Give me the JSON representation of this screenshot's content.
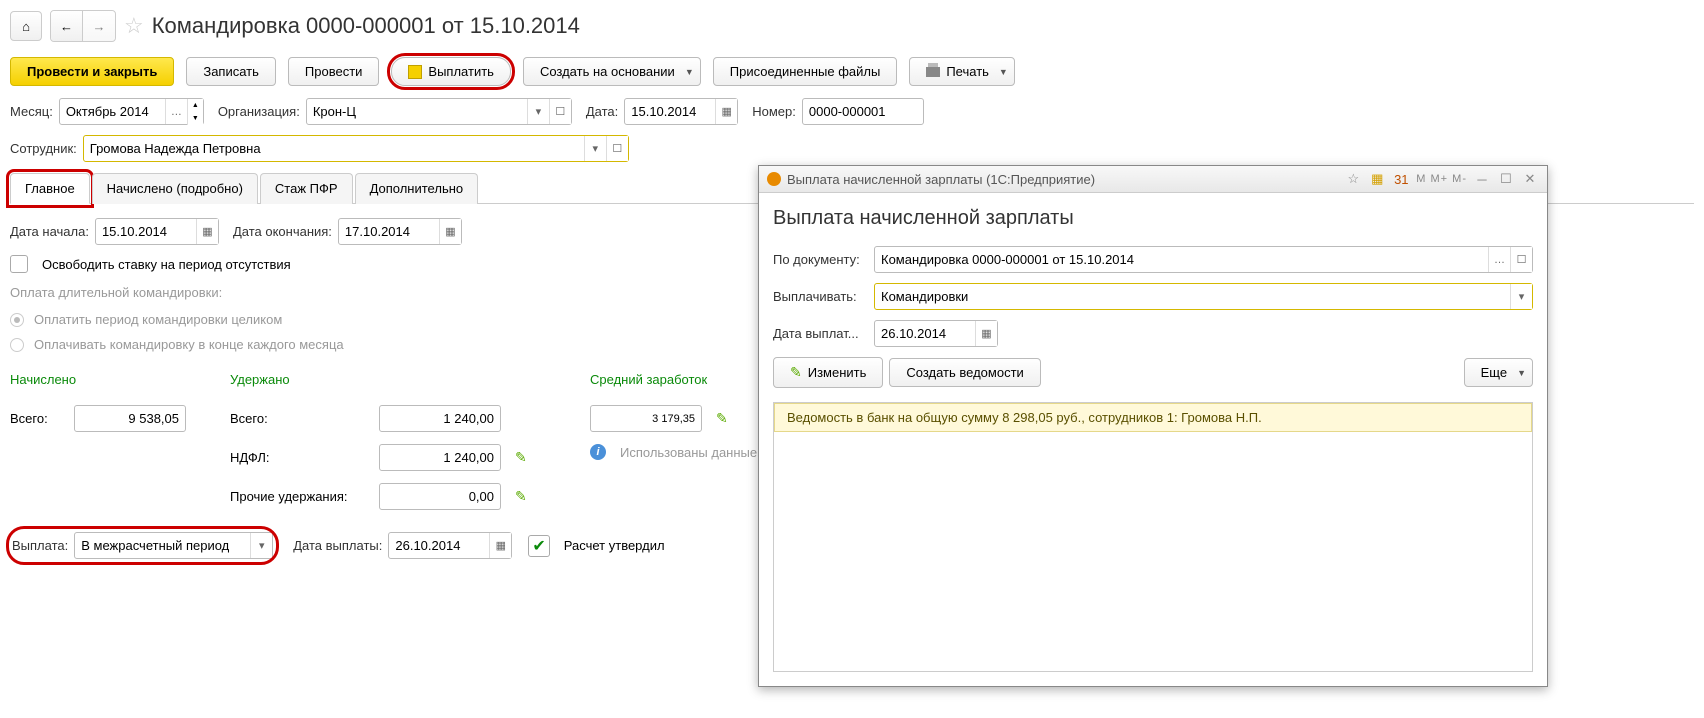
{
  "page_title": "Командировка 0000-000001 от 15.10.2014",
  "toolbar": {
    "post_close": "Провести и закрыть",
    "save": "Записать",
    "post": "Провести",
    "pay": "Выплатить",
    "create_based": "Создать на основании",
    "attached_files": "Присоединенные файлы",
    "print": "Печать"
  },
  "form": {
    "month_label": "Месяц:",
    "month_value": "Октябрь 2014",
    "org_label": "Организация:",
    "org_value": "Крон-Ц",
    "date_label": "Дата:",
    "date_value": "15.10.2014",
    "number_label": "Номер:",
    "number_value": "0000-000001",
    "employee_label": "Сотрудник:",
    "employee_value": "Громова Надежда Петровна"
  },
  "tabs": [
    "Главное",
    "Начислено (подробно)",
    "Стаж ПФР",
    "Дополнительно"
  ],
  "main_tab": {
    "start_date_label": "Дата начала:",
    "start_date": "15.10.2014",
    "end_date_label": "Дата окончания:",
    "end_date": "17.10.2014",
    "free_rate": "Освободить ставку на период отсутствия",
    "long_trip_label": "Оплата длительной командировки:",
    "radio_whole": "Оплатить период командировки целиком",
    "radio_monthly": "Оплачивать командировку в конце каждого месяца",
    "accrued_header": "Начислено",
    "withheld_header": "Удержано",
    "avg_salary_header": "Средний заработок",
    "total_label": "Всего:",
    "accrued_total": "9 538,05",
    "withheld_total": "1 240,00",
    "ndfl_label": "НДФЛ:",
    "ndfl_value": "1 240,00",
    "other_label": "Прочие удержания:",
    "other_value": "0,00",
    "avg_value": "3 179,35",
    "data_used_label": "Использованы данные о",
    "payment_label": "Выплата:",
    "payment_value": "В межрасчетный период",
    "pay_date_label": "Дата выплаты:",
    "pay_date_value": "26.10.2014",
    "calc_approved": "Расчет утвердил"
  },
  "dialog": {
    "titlebar": "Выплата начисленной зарплаты  (1С:Предприятие)",
    "heading": "Выплата начисленной зарплаты",
    "by_doc_label": "По документу:",
    "by_doc_value": "Командировка 0000-000001 от 15.10.2014",
    "pay_what_label": "Выплачивать:",
    "pay_what_value": "Командировки",
    "pay_date_label": "Дата выплат...",
    "pay_date_value": "26.10.2014",
    "edit_btn": "Изменить",
    "create_sheets": "Создать ведомости",
    "more_btn": "Еще",
    "yellow_text": "Ведомость в банк на общую сумму 8 298,05 руб., сотрудников 1: Громова Н.П.",
    "titlebar_suffix": "M  M+  M-"
  }
}
